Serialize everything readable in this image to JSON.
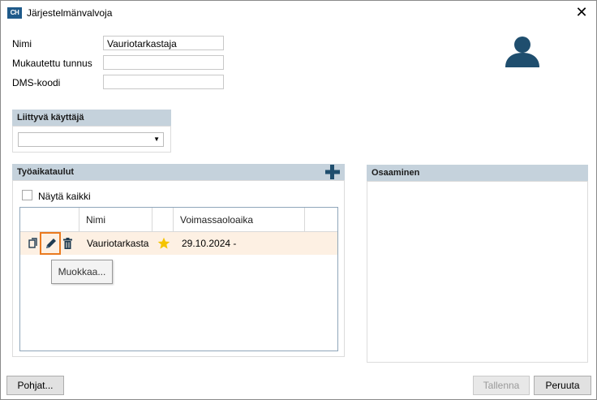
{
  "window": {
    "app_icon_text": "CH",
    "title": "Järjestelmänvalvoja",
    "close_glyph": "✕"
  },
  "form": {
    "name_label": "Nimi",
    "name_value": "Vauriotarkastaja",
    "custom_id_label": "Mukautettu tunnus",
    "custom_id_value": "",
    "dms_label": "DMS-koodi",
    "dms_value": ""
  },
  "linked_user": {
    "header": "Liittyvä käyttäjä",
    "selected": ""
  },
  "schedules": {
    "header": "Työaikataulut",
    "show_all_label": "Näytä kaikki",
    "show_all_checked": false,
    "columns": [
      "",
      "Nimi",
      "",
      "Voimassaoloaika",
      ""
    ],
    "rows": [
      {
        "name": "Vauriotarkasta",
        "validity": "29.10.2024 -",
        "favorite": true
      }
    ],
    "tooltip": "Muokkaa..."
  },
  "skills": {
    "header": "Osaaminen"
  },
  "buttons": {
    "templates": "Pohjat...",
    "save": "Tallenna",
    "cancel": "Peruuta"
  },
  "colors": {
    "accent": "#1f5a8a",
    "group_header": "#c5d2dc",
    "row_highlight": "#fdf0e3",
    "focus_outline": "#ea7a1f",
    "star": "#f5c400"
  }
}
